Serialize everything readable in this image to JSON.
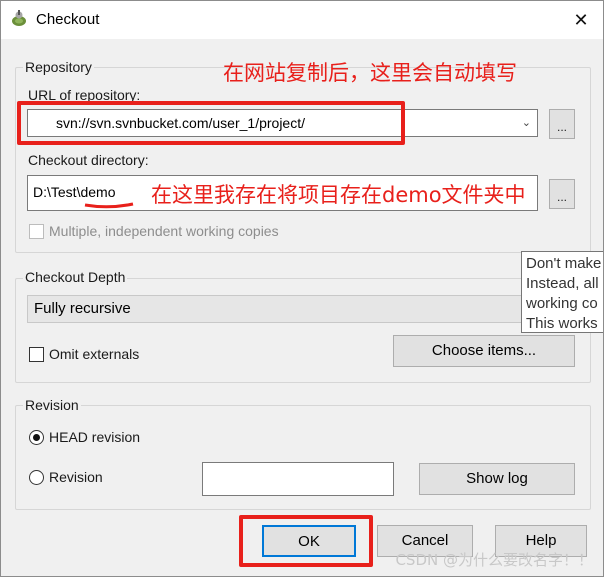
{
  "window": {
    "title": "Checkout",
    "close": "✕"
  },
  "repository": {
    "group_label": "Repository",
    "url_label": "URL of repository:",
    "url_value": "svn://svn.svnbucket.com/user_1/project/",
    "browse_label": "...",
    "dir_label": "Checkout directory:",
    "dir_prefix": "D:\\Test\\",
    "dir_suffix": "demo",
    "dir_browse_label": "...",
    "multiple_label": "Multiple, independent working copies",
    "multiple_checked": false,
    "multiple_enabled": false
  },
  "depth": {
    "group_label": "Checkout Depth",
    "selected": "Fully recursive",
    "omit_label": "Omit externals",
    "omit_checked": false,
    "choose_items_label": "Choose items..."
  },
  "tooltip": {
    "lines": [
      "Don't make",
      "Instead, all",
      "working co",
      "This works"
    ]
  },
  "revision": {
    "group_label": "Revision",
    "head_label": "HEAD revision",
    "revision_label": "Revision",
    "selected": "head",
    "revision_value": "",
    "show_log_label": "Show log"
  },
  "buttons": {
    "ok": "OK",
    "cancel": "Cancel",
    "help": "Help"
  },
  "annotations": {
    "url_note": "在网站复制后，这里会自动填写",
    "dir_note": "在这里我存在将项目存在demo文件夹中",
    "color": "#e8201b"
  },
  "watermark": "CSDN @为什么要改名字！！"
}
